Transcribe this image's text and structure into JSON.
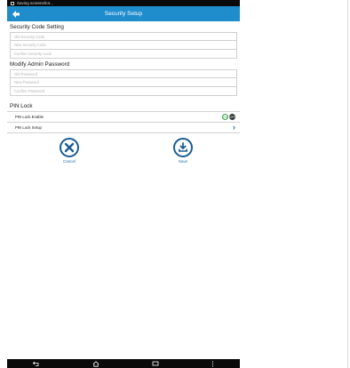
{
  "status_bar": {
    "notification_text": "Saving screenshot..."
  },
  "app_bar": {
    "title": "Security Setup",
    "back_icon": "back-arrow-icon"
  },
  "security_code": {
    "heading": "Security Code Setting",
    "fields": [
      {
        "placeholder": "Old Security Code"
      },
      {
        "placeholder": "New Security Code"
      },
      {
        "placeholder": "Confirm Security Code"
      }
    ]
  },
  "admin_password": {
    "heading": "Modify Admin Password",
    "fields": [
      {
        "placeholder": "Old Password"
      },
      {
        "placeholder": "New Password"
      },
      {
        "placeholder": "Confirm Password"
      }
    ]
  },
  "pin_lock": {
    "heading": "PIN Lock",
    "enable_label": "PIN Lock Enable",
    "toggle_on": "ON",
    "toggle_off": "OFF",
    "setup_label": "PIN Lock Setup",
    "setup_icon": "chevron-right-icon"
  },
  "actions": {
    "cancel_label": "Cancel",
    "cancel_icon": "close-icon",
    "save_label": "Save",
    "save_icon": "download-save-icon"
  },
  "colors": {
    "app_bar": "#1f8ccc",
    "accent": "#1a5c94",
    "toggle_on": "#35a34a"
  }
}
